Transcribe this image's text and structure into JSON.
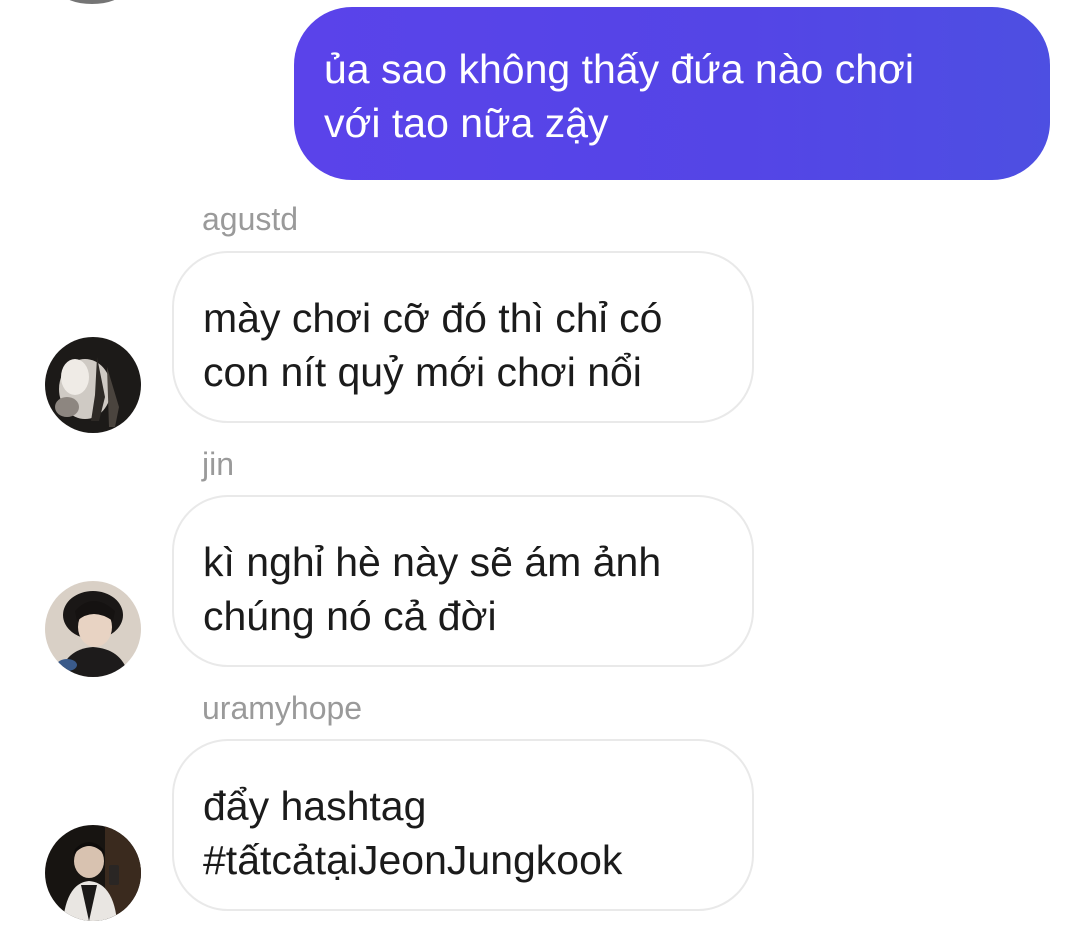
{
  "outgoing": {
    "text": "ủa sao không thấy đứa nào chơi\nvới tao nữa zậy",
    "color": "#5445e6"
  },
  "messages": [
    {
      "sender": "agustd",
      "text": "mày chơi cỡ đó thì chỉ có\ncon nít quỷ mới chơi nổi"
    },
    {
      "sender": "jin",
      "text": "kì nghỉ hè này sẽ ám ảnh\nchúng nó cả đời"
    },
    {
      "sender": "uramyhope",
      "text": "đẩy hashtag\n#tấtcảtạiJeonJungkook"
    }
  ]
}
